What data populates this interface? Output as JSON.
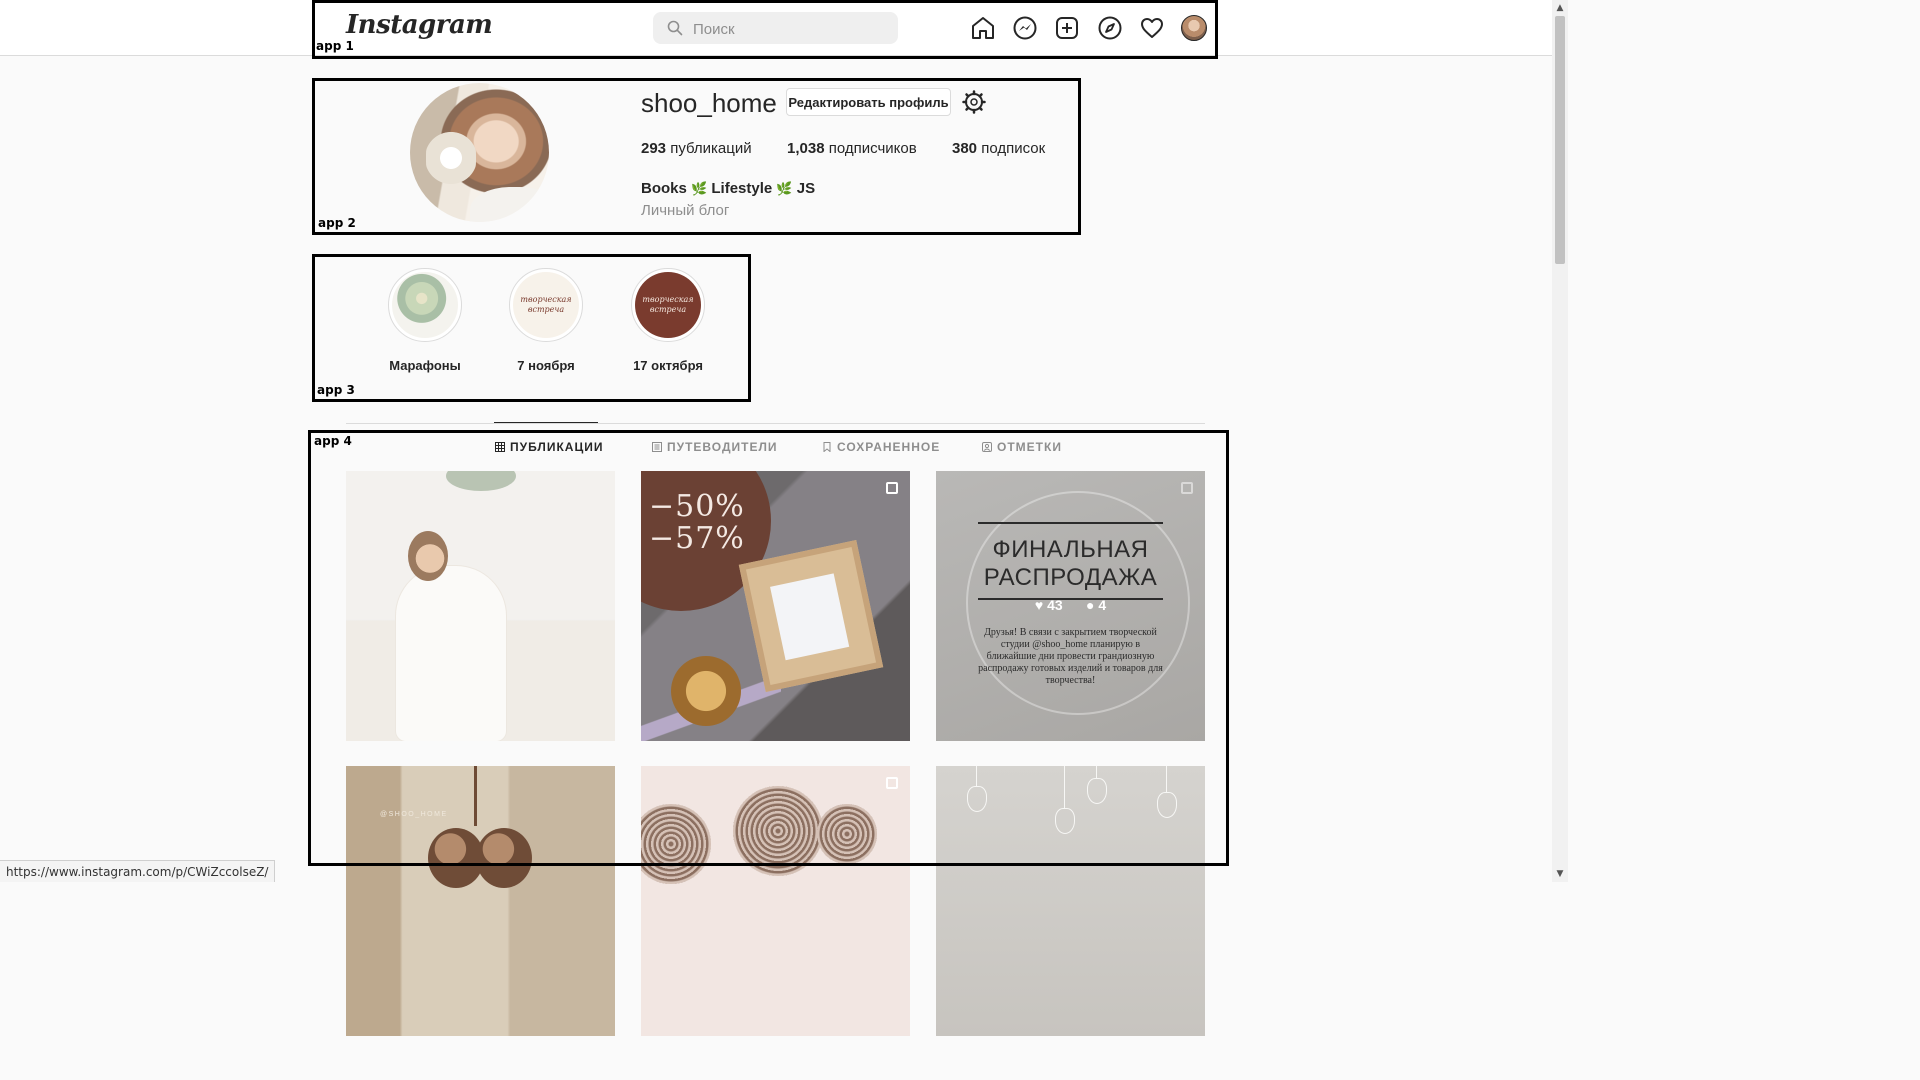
{
  "app_labels": [
    "app 1",
    "app 2",
    "app 3",
    "app 4"
  ],
  "header": {
    "logo": "Instagram",
    "search_placeholder": "Поиск",
    "nav_icons": [
      "home-icon",
      "messenger-icon",
      "new-post-icon",
      "explore-icon",
      "activity-heart-icon",
      "profile-avatar"
    ]
  },
  "profile": {
    "username": "shoo_home",
    "edit_button": "Редактировать профиль",
    "stats": {
      "posts_value": "293",
      "posts_label": "публикаций",
      "followers_value": "1,038",
      "followers_label": "подписчиков",
      "following_value": "380",
      "following_label": "подписок"
    },
    "bio_parts": [
      "Books",
      "Lifestyle",
      "JS"
    ],
    "bio_leaf": "🌿",
    "category": "Личный блог"
  },
  "highlights": [
    {
      "label": "Марафоны",
      "cover_text": ""
    },
    {
      "label": "7 ноября",
      "cover_text": "творческая встреча"
    },
    {
      "label": "17 октября",
      "cover_text": "творческая встреча"
    }
  ],
  "tabs": [
    {
      "label": "ПУБЛИКАЦИИ",
      "active": true,
      "icon": "grid-icon"
    },
    {
      "label": "ПУТЕВОДИТЕЛИ",
      "active": false,
      "icon": "guide-icon"
    },
    {
      "label": "СОХРАНЕННОЕ",
      "active": false,
      "icon": "bookmark-icon"
    },
    {
      "label": "ОТМЕТКИ",
      "active": false,
      "icon": "tagged-icon"
    }
  ],
  "posts": {
    "p2_discount": [
      "−50%",
      "−57%"
    ],
    "p3_title_line1": "ФИНАЛЬНАЯ",
    "p3_title_line2": "РАСПРОДАЖА",
    "p3_likes": "43",
    "p3_comments": "4",
    "p3_text": "Друзья! В связи с закрытием творческой студии @shoo_home планирую в ближайшие дни провести грандиозную распродажу готовых изделий и товаров для творчества!",
    "p4_watermark": "@SHOO_HOME"
  },
  "status_bar": {
    "url": "https://www.instagram.com/p/CWiZccolseZ/"
  },
  "colors": {
    "text": "#262626",
    "muted": "#8e8e8e",
    "border": "#dbdbdb",
    "background": "#fafafa",
    "leaf": "#6aa84f",
    "highlight_brown": "#7a3b2e"
  }
}
